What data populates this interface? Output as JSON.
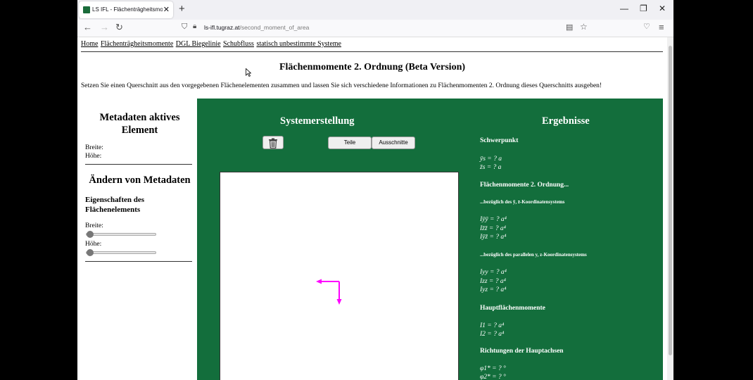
{
  "browser": {
    "tab_title": "LS IFL - Flächenträgheitsmomente",
    "url_domain": "ls-ifl.tugraz.at",
    "url_path": "/second_moment_of_area"
  },
  "nav": {
    "links": [
      "Home",
      "Flächenträgheitsmomente",
      "DGL Biegelinie",
      "Schubfluss",
      "statisch unbestimmte Systeme"
    ]
  },
  "page": {
    "title": "Flächenmomente 2. Ordnung (Beta Version)",
    "intro": "Setzen Sie einen Querschnitt aus den vorgegebenen Flächenelementen zusammen und lassen Sie sich verschiedene Informationen zu Flächenmomenten 2. Ordnung dieses Querschnitts ausgeben!"
  },
  "left": {
    "meta_title": "Metadaten aktives Element",
    "breite_label": "Breite:",
    "hoehe_label": "Höhe:",
    "edit_title": "Ändern von Metadaten",
    "props_title": "Eigenschaften des Flächenelements",
    "slider_breite_label": "Breite:",
    "slider_hoehe_label": "Höhe:",
    "slider_breite_value": 0,
    "slider_hoehe_value": 0
  },
  "system": {
    "title": "Systemerstellung",
    "teile_button": "Teile",
    "ausschnitte_button": "Ausschnitte"
  },
  "results": {
    "title": "Ergebnisse",
    "schwerpunkt": "Schwerpunkt",
    "ys": "ȳs = ? a",
    "zs": "z̄s = ? a",
    "fm_title": "Flächenmomente 2. Ordnung...",
    "fm_bar_sub": "...bezüglich des ȳ, z̄-Koordinatensystems",
    "iyy_bar": "Iȳȳ = ? a⁴",
    "izz_bar": "Iz̄z̄ = ? a⁴",
    "iyz_bar": "Iȳz̄ = ? a⁴",
    "fm_par_sub": "...bezüglich des parallelen y, z-Koordinatensystems",
    "iyy": "Iyy = ? a⁴",
    "izz": "Izz = ? a⁴",
    "iyz": "Iyz = ? a⁴",
    "haupt_title": "Hauptflächenmomente",
    "i1": "I1 = ? a⁴",
    "i2": "I2 = ? a⁴",
    "richtung_title": "Richtungen der Hauptachsen",
    "phi1": "φ1* = ? °",
    "phi2": "φ2* = ? °"
  },
  "colors": {
    "panel_green": "#136e3c",
    "axis_magenta": "#ff00ff"
  }
}
